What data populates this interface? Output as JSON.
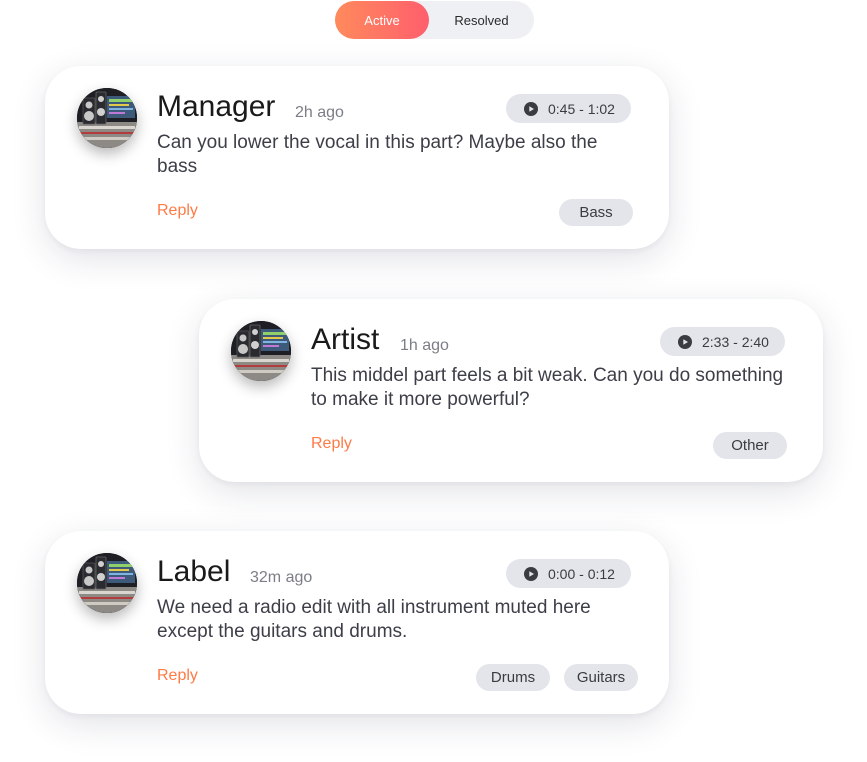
{
  "filter_toggle": {
    "active_label": "Active",
    "resolved_label": "Resolved"
  },
  "comments": [
    {
      "author": "Manager",
      "time_ago": "2h ago",
      "time_range": "0:45 - 1:02",
      "message": "Can you lower the vocal in this part? Maybe also the bass",
      "reply_label": "Reply",
      "tags": [
        "Bass"
      ]
    },
    {
      "author": "Artist",
      "time_ago": "1h ago",
      "time_range": "2:33 - 2:40",
      "message": "This middel part feels a bit weak. Can you do something to make it more powerful?",
      "reply_label": "Reply",
      "tags": [
        "Other"
      ]
    },
    {
      "author": "Label",
      "time_ago": "32m ago",
      "time_range": "0:00 - 0:12",
      "message": "We need a radio edit with all instrument muted here except the guitars and drums.",
      "reply_label": "Reply",
      "tags": [
        "Drums",
        "Guitars"
      ]
    }
  ],
  "colors": {
    "accent": "#ff7a45",
    "gradient_start": "#ff8a5c",
    "gradient_end": "#ff5f6d",
    "pill_bg": "#e3e5ea"
  },
  "icons": {
    "play": "play-icon",
    "avatar": "studio-avatar"
  }
}
